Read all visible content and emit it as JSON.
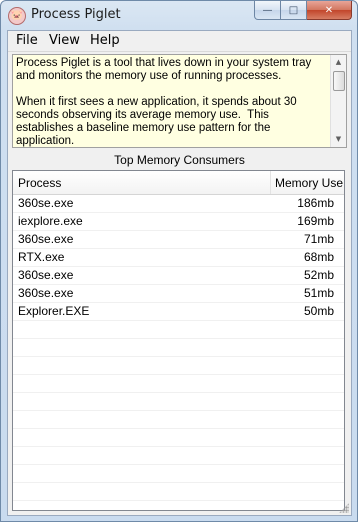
{
  "window": {
    "title": "Process Piglet",
    "icon": "pig-icon",
    "caption_buttons": {
      "minimize": "—",
      "maximize": "□",
      "close": "✕"
    }
  },
  "menu": [
    {
      "label": "File"
    },
    {
      "label": "View"
    },
    {
      "label": "Help"
    }
  ],
  "description": {
    "text": "Process Piglet is a tool that lives down in your system tray and monitors the memory use of running processes.\n\nWhen it first sees a new application, it spends about 30 seconds observing its average memory use.  This establishes a baseline memory use pattern for the application."
  },
  "section_title": "Top Memory Consumers",
  "table": {
    "columns": [
      "Process",
      "Memory Use"
    ],
    "rows": [
      {
        "process": "360se.exe",
        "memory": "186mb"
      },
      {
        "process": "iexplore.exe",
        "memory": "169mb"
      },
      {
        "process": "360se.exe",
        "memory": "71mb"
      },
      {
        "process": "RTX.exe",
        "memory": "68mb"
      },
      {
        "process": "360se.exe",
        "memory": "52mb"
      },
      {
        "process": "360se.exe",
        "memory": "51mb"
      },
      {
        "process": "Explorer.EXE",
        "memory": "50mb"
      }
    ],
    "empty_rows": 10
  }
}
